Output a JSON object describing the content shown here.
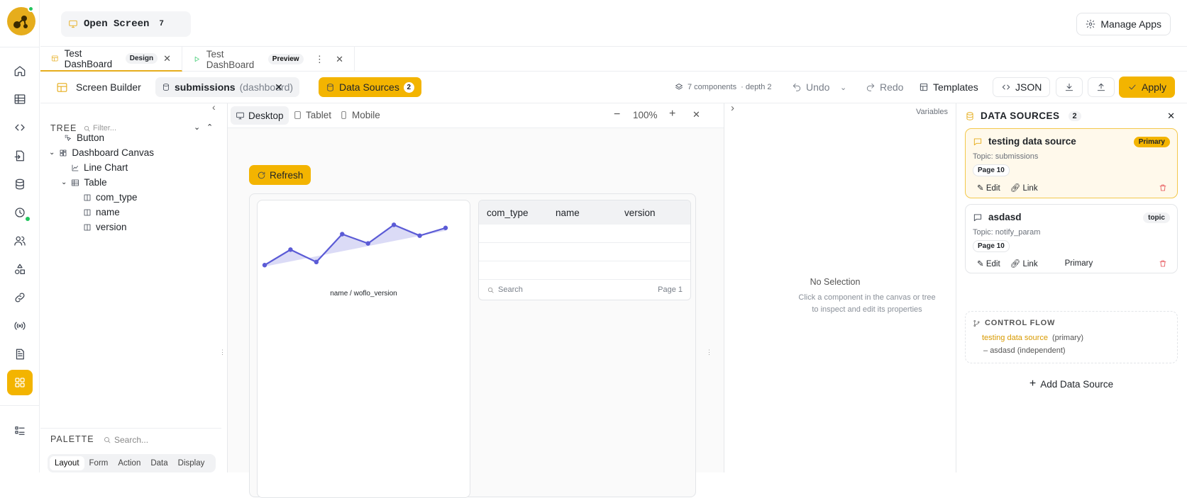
{
  "topbar": {
    "open_screen": "Open Screen",
    "open_count": "7",
    "manage_apps": "Manage Apps"
  },
  "tabs": [
    {
      "label": "Test DashBoard",
      "badge": "Design"
    },
    {
      "label": "Test DashBoard",
      "badge": "Preview"
    }
  ],
  "toolbar": {
    "title": "Screen Builder",
    "submissions": "submissions",
    "submissions_kind": "(dashboard)",
    "data_sources": "Data Sources",
    "data_sources_count": "2",
    "components": "7 components",
    "depth": "· depth 2",
    "undo": "Undo",
    "redo": "Redo",
    "templates": "Templates",
    "json": "JSON",
    "apply": "Apply"
  },
  "tree": {
    "heading": "TREE",
    "filter_placeholder": "Filter...",
    "items": [
      "Button",
      "Dashboard Canvas",
      "Line Chart",
      "Table",
      "com_type",
      "name",
      "version"
    ]
  },
  "palette": {
    "heading": "PALETTE",
    "search_placeholder": "Search...",
    "tabs": [
      "Layout",
      "Form",
      "Action",
      "Data",
      "Display"
    ]
  },
  "canvas": {
    "devices": [
      "Desktop",
      "Tablet",
      "Mobile"
    ],
    "zoom": "100%",
    "refresh": "Refresh",
    "chart_caption": "name / woflo_version",
    "table_columns": [
      "com_type",
      "name",
      "version"
    ],
    "table_search": "Search",
    "table_page": "Page 1"
  },
  "chart_data": {
    "type": "line",
    "x": [
      1,
      2,
      3,
      4,
      5,
      6,
      7,
      8
    ],
    "values": [
      1,
      2,
      1.2,
      3,
      2.4,
      3.6,
      2.9,
      3.4
    ],
    "xlabel": "name / woflo_version",
    "ylabel": ""
  },
  "inspector": {
    "variables": "Variables",
    "no_selection": "No Selection",
    "hint": "Click a component in the canvas or tree to inspect and edit its properties"
  },
  "datasources": {
    "heading": "DATA SOURCES",
    "count": "2",
    "cards": [
      {
        "name": "testing data source",
        "pill": "Primary",
        "topic": "Topic: submissions",
        "page": "Page 10",
        "edit": "Edit",
        "link": "Link",
        "extra": ""
      },
      {
        "name": "asdasd",
        "pill": "topic",
        "topic": "Topic: notify_param",
        "page": "Page 10",
        "edit": "Edit",
        "link": "Link",
        "extra": "Primary"
      }
    ],
    "control_flow": {
      "heading": "CONTROL FLOW",
      "primary_name": "testing data source",
      "primary_tag": "(primary)",
      "secondary": "asdasd (independent)"
    },
    "add": "Add Data Source"
  },
  "colors": {
    "accent": "#f3b400",
    "series": "#5b5bd6",
    "danger": "#e5484d",
    "online": "#22c55e"
  }
}
